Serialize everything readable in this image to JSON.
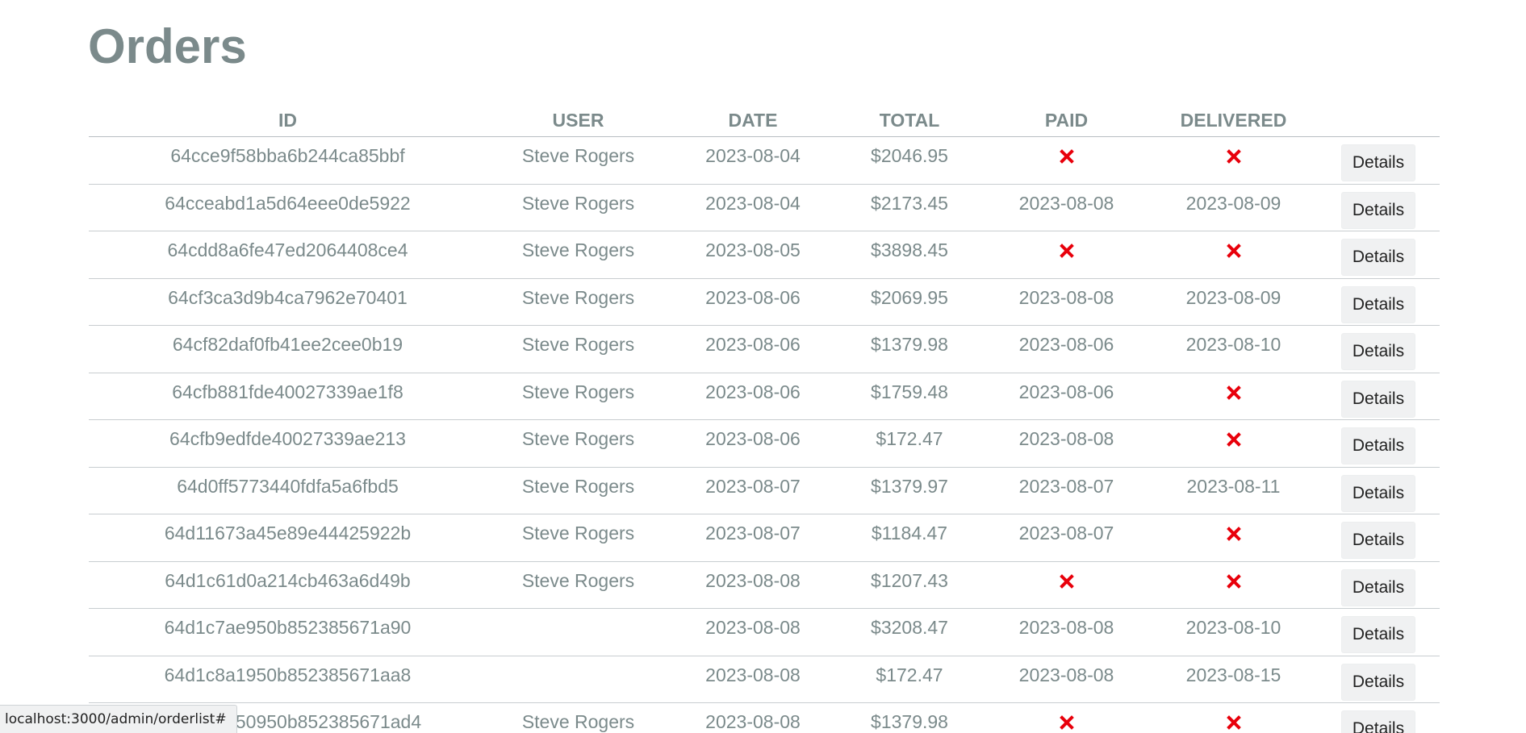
{
  "page": {
    "title": "Orders"
  },
  "table": {
    "headers": [
      "ID",
      "USER",
      "DATE",
      "TOTAL",
      "PAID",
      "DELIVERED",
      ""
    ],
    "details_label": "Details",
    "rows": [
      {
        "id": "64cce9f58bba6b244ca85bbf",
        "user": "Steve Rogers",
        "date": "2023-08-04",
        "total": "$2046.95",
        "paid": "",
        "paid_status": "no",
        "delivered": "",
        "delivered_status": "no"
      },
      {
        "id": "64cceabd1a5d64eee0de5922",
        "user": "Steve Rogers",
        "date": "2023-08-04",
        "total": "$2173.45",
        "paid": "2023-08-08",
        "paid_status": "yes",
        "delivered": "2023-08-09",
        "delivered_status": "yes"
      },
      {
        "id": "64cdd8a6fe47ed2064408ce4",
        "user": "Steve Rogers",
        "date": "2023-08-05",
        "total": "$3898.45",
        "paid": "",
        "paid_status": "no",
        "delivered": "",
        "delivered_status": "no"
      },
      {
        "id": "64cf3ca3d9b4ca7962e70401",
        "user": "Steve Rogers",
        "date": "2023-08-06",
        "total": "$2069.95",
        "paid": "2023-08-08",
        "paid_status": "yes",
        "delivered": "2023-08-09",
        "delivered_status": "yes"
      },
      {
        "id": "64cf82daf0fb41ee2cee0b19",
        "user": "Steve Rogers",
        "date": "2023-08-06",
        "total": "$1379.98",
        "paid": "2023-08-06",
        "paid_status": "yes",
        "delivered": "2023-08-10",
        "delivered_status": "yes"
      },
      {
        "id": "64cfb881fde40027339ae1f8",
        "user": "Steve Rogers",
        "date": "2023-08-06",
        "total": "$1759.48",
        "paid": "2023-08-06",
        "paid_status": "yes",
        "delivered": "",
        "delivered_status": "no"
      },
      {
        "id": "64cfb9edfde40027339ae213",
        "user": "Steve Rogers",
        "date": "2023-08-06",
        "total": "$172.47",
        "paid": "2023-08-08",
        "paid_status": "yes",
        "delivered": "",
        "delivered_status": "no"
      },
      {
        "id": "64d0ff5773440fdfa5a6fbd5",
        "user": "Steve Rogers",
        "date": "2023-08-07",
        "total": "$1379.97",
        "paid": "2023-08-07",
        "paid_status": "yes",
        "delivered": "2023-08-11",
        "delivered_status": "yes"
      },
      {
        "id": "64d11673a45e89e44425922b",
        "user": "Steve Rogers",
        "date": "2023-08-07",
        "total": "$1184.47",
        "paid": "2023-08-07",
        "paid_status": "yes",
        "delivered": "",
        "delivered_status": "no"
      },
      {
        "id": "64d1c61d0a214cb463a6d49b",
        "user": "Steve Rogers",
        "date": "2023-08-08",
        "total": "$1207.43",
        "paid": "",
        "paid_status": "no",
        "delivered": "",
        "delivered_status": "no"
      },
      {
        "id": "64d1c7ae950b852385671a90",
        "user": "",
        "date": "2023-08-08",
        "total": "$3208.47",
        "paid": "2023-08-08",
        "paid_status": "yes",
        "delivered": "2023-08-10",
        "delivered_status": "yes"
      },
      {
        "id": "64d1c8a1950b852385671aa8",
        "user": "",
        "date": "2023-08-08",
        "total": "$172.47",
        "paid": "2023-08-08",
        "paid_status": "yes",
        "delivered": "2023-08-15",
        "delivered_status": "yes"
      },
      {
        "id": "64d1c8b950950b852385671ad4",
        "user": "Steve Rogers",
        "date": "2023-08-08",
        "total": "$1379.98",
        "paid": "",
        "paid_status": "no",
        "delivered": "",
        "delivered_status": "no"
      }
    ]
  },
  "status_bar": {
    "url": "localhost:3000/admin/orderlist#"
  },
  "colors": {
    "heading": "#7b8a8b",
    "cell_text": "#7b8a8b",
    "x_icon": "#e8000b",
    "button_bg": "#f0f1f2"
  },
  "icons": {
    "not_paid": "x-icon",
    "not_delivered": "x-icon"
  }
}
